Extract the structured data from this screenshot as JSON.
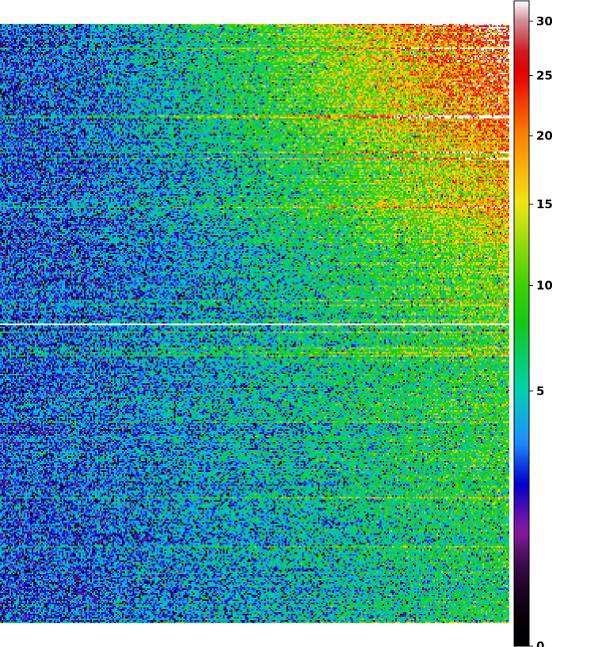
{
  "chart_data": {
    "type": "heatmap",
    "title": "",
    "xlabel": "",
    "ylabel": "",
    "colorbar": {
      "range": [
        0,
        32
      ],
      "scale": "sqrt",
      "ticks": [
        0,
        5,
        10,
        15,
        20,
        25,
        30
      ],
      "tick_labels": [
        "0",
        "5",
        "10",
        "15",
        "20",
        "25",
        "30"
      ],
      "colormap": [
        {
          "v": 0,
          "color": "#000000"
        },
        {
          "v": 0.5,
          "color": "#3a0a4a"
        },
        {
          "v": 1,
          "color": "#8a1aa0"
        },
        {
          "v": 2,
          "color": "#0000cc"
        },
        {
          "v": 3.2,
          "color": "#1f8fff"
        },
        {
          "v": 5,
          "color": "#00d2b0"
        },
        {
          "v": 8,
          "color": "#14c814"
        },
        {
          "v": 10,
          "color": "#3cd200"
        },
        {
          "v": 15,
          "color": "#f0e614"
        },
        {
          "v": 20,
          "color": "#ff8200"
        },
        {
          "v": 25,
          "color": "#e60000"
        },
        {
          "v": 27,
          "color": "#d21414"
        },
        {
          "v": 30,
          "color": "#d28c96"
        },
        {
          "v": 32,
          "color": "#ffffff"
        }
      ]
    },
    "field": {
      "rows": 380,
      "cols": 322,
      "description_values": "counts increase from ~2 at left to ~28 at upper-right corner; lower half roughly 3-8",
      "top_left": 2.5,
      "top_right": 28,
      "mid_right": 9,
      "bottom_left": 2.5,
      "bottom_right": 7,
      "gap_row_fraction": 0.5
    }
  }
}
